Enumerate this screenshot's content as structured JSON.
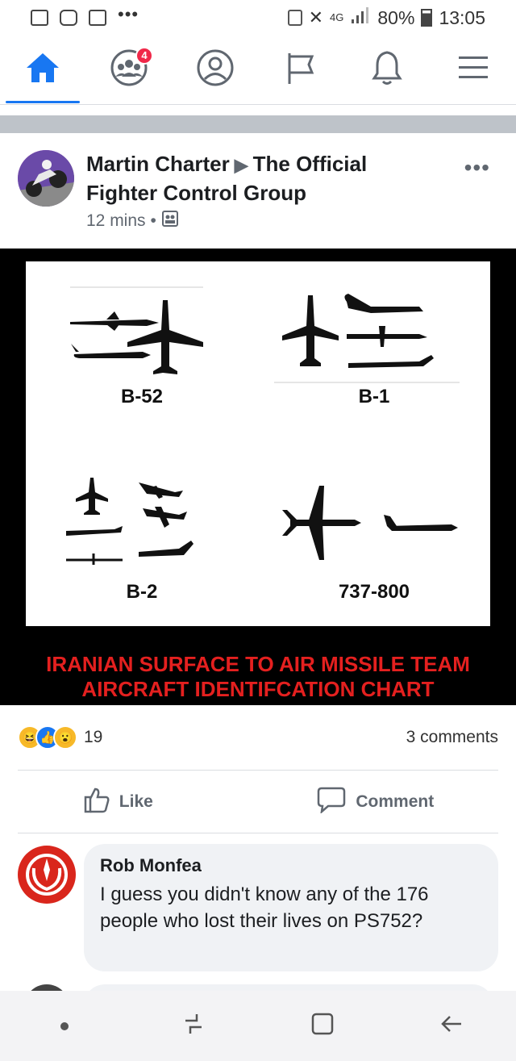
{
  "status_bar": {
    "battery": "80%",
    "time": "13:05",
    "network": "4G",
    "overflow": "•••"
  },
  "tab_bar": {
    "tabs": [
      {
        "name": "home",
        "icon": "home-icon",
        "active": true
      },
      {
        "name": "groups",
        "icon": "groups-icon",
        "badge": "4"
      },
      {
        "name": "profile",
        "icon": "profile-icon"
      },
      {
        "name": "pages",
        "icon": "flag-icon"
      },
      {
        "name": "notifications",
        "icon": "bell-icon"
      },
      {
        "name": "menu",
        "icon": "hamburger-icon"
      }
    ],
    "accent_color": "#1877f2"
  },
  "post": {
    "author": "Martin Charter",
    "group": "The Official Fighter Control Group",
    "time": "12 mins",
    "more_label": "•••",
    "image": {
      "cells": [
        {
          "label": "B-52"
        },
        {
          "label": "B-1"
        },
        {
          "label": "B-2"
        },
        {
          "label": "737-800"
        }
      ],
      "caption_line1": "IRANIAN SURFACE TO AIR MISSILE TEAM",
      "caption_line2": "AIRCRAFT IDENTIFCATION CHART",
      "caption_color": "#e4201f"
    },
    "reactions_count": "19",
    "comments_count": "3 comments",
    "actions": {
      "like": "Like",
      "comment": "Comment"
    }
  },
  "comment": {
    "author": "Rob Monfea",
    "text": "I guess you didn't know any of the 176 people who lost their lives on PS752?"
  }
}
